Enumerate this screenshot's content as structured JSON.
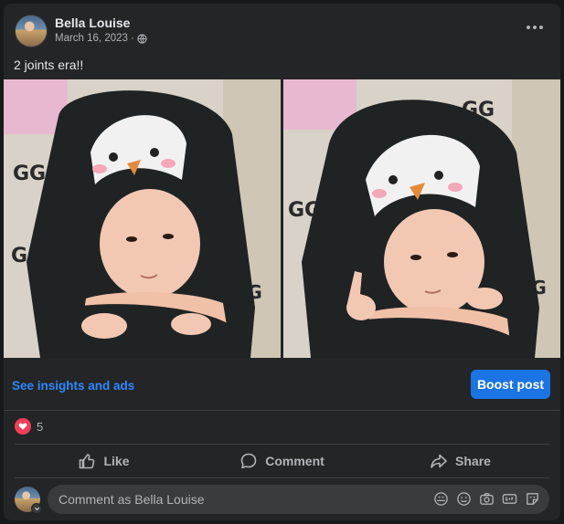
{
  "post": {
    "author": "Bella Louise",
    "date": "March 16, 2023",
    "separator": "·",
    "privacy_icon": "globe-icon",
    "caption": "2 joints era!!"
  },
  "insights": {
    "link": "See insights and ads",
    "boost": "Boost post"
  },
  "reactions": {
    "icon": "heart-icon",
    "count": "5"
  },
  "actions": [
    {
      "label": "Like",
      "icon": "thumbs-up-icon"
    },
    {
      "label": "Comment",
      "icon": "comment-bubble-icon"
    },
    {
      "label": "Share",
      "icon": "share-arrow-icon"
    }
  ],
  "comment": {
    "placeholder": "Comment as Bella Louise",
    "icons": [
      "avatar-sticker-icon",
      "emoji-icon",
      "camera-icon",
      "gif-icon",
      "sticker-icon"
    ]
  },
  "colors": {
    "background": "#18191a",
    "card": "#242526",
    "link": "#2d88ff",
    "boost": "#1b74e4",
    "heart": "#f33e58"
  }
}
